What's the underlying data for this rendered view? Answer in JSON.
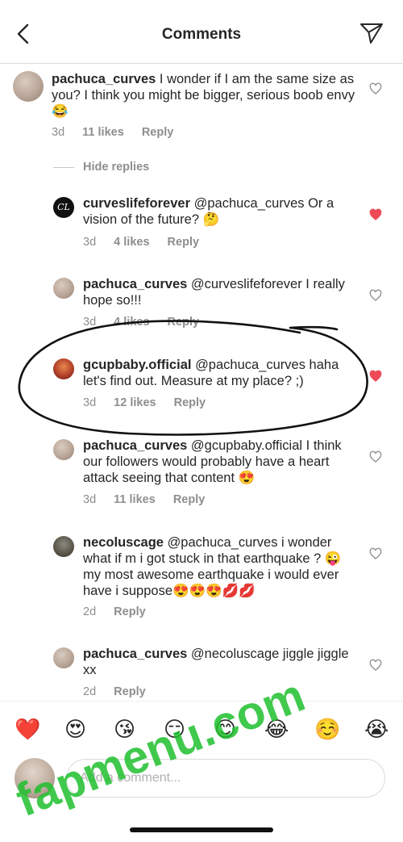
{
  "header": {
    "title": "Comments"
  },
  "comments": [
    {
      "user": "pachuca_curves",
      "text": "I wonder if I am the same size as you? I think you might be bigger, serious boob envy 😂",
      "time": "3d",
      "likes": "11 likes",
      "reply": "Reply",
      "liked": false
    },
    {
      "user": "curveslifeforever",
      "text": "@pachuca_curves Or a vision of the future? 🤔",
      "time": "3d",
      "likes": "4 likes",
      "reply": "Reply",
      "liked": true
    },
    {
      "user": "pachuca_curves",
      "text": "@curveslifeforever I really hope so!!!",
      "time": "3d",
      "likes": "4 likes",
      "reply": "Reply",
      "liked": false
    },
    {
      "user": "gcupbaby.official",
      "text": "@pachuca_curves haha let's find out. Measure at my place? ;)",
      "time": "3d",
      "likes": "12 likes",
      "reply": "Reply",
      "liked": true
    },
    {
      "user": "pachuca_curves",
      "text": "@gcupbaby.official I think our followers would probably have a heart attack seeing that content 😍",
      "time": "3d",
      "likes": "11 likes",
      "reply": "Reply",
      "liked": false
    },
    {
      "user": "necoluscage",
      "text": "@pachuca_curves i wonder what if m i got stuck in that earthquake ? 😜 my most awesome earthquake i would ever have i suppose😍😍😍💋💋",
      "time": "2d",
      "likes": "",
      "reply": "Reply",
      "liked": false
    },
    {
      "user": "pachuca_curves",
      "text": "@necoluscage jiggle jiggle xx",
      "time": "2d",
      "likes": "",
      "reply": "Reply",
      "liked": false
    }
  ],
  "hide_replies": "Hide replies",
  "avatar_initials": "CL",
  "emoji_bar": [
    "❤️",
    "😍",
    "😘",
    "😏",
    "😊",
    "😂",
    "☺️",
    "😭"
  ],
  "input": {
    "placeholder": "Add a comment..."
  },
  "watermark": "fapmenu.com",
  "colors": {
    "heart_liked": "#ed4956",
    "heart_outline": "#8e8e8e",
    "watermark": "#1fbf2e"
  }
}
